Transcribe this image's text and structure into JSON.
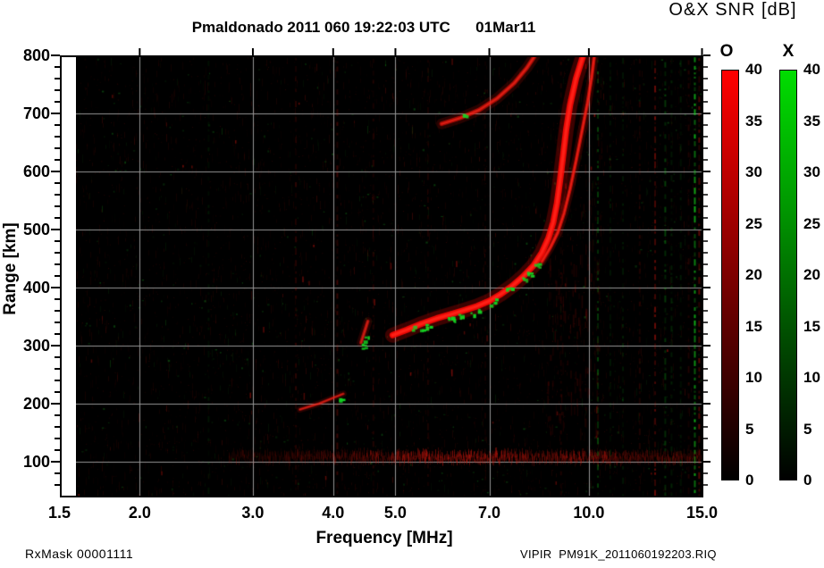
{
  "labels": {
    "title": "Pmaldonado 2011 060 19:22:03 UTC      01Mar11",
    "colorbar_title": "O&X SNR [dB]",
    "x_axis": "Frequency [MHz]",
    "y_axis": "Range [km]",
    "footer_left": "RxMask 00001111",
    "footer_right": "VIPIR  PM91K_2011060192203.RIQ"
  },
  "colorbar": {
    "o_label": "O",
    "x_label": "X",
    "ticks": [
      40,
      35,
      30,
      25,
      20,
      15,
      10,
      5,
      0
    ],
    "o_top_color": "#ff0000",
    "x_top_color": "#00dd00",
    "unit": "dB"
  },
  "chart_data": {
    "type": "heatmap",
    "description": "VIPIR ionogram: O-mode (red) and X-mode (green) SNR versus sounding frequency and virtual range",
    "title": "Pmaldonado 2011 060 19:22:03 UTC      01Mar11",
    "xlabel": "Frequency [MHz]",
    "ylabel": "Range [km]",
    "x_axis": {
      "scale": "log",
      "min": 1.5,
      "max": 15.0,
      "tick_values": [
        1.5,
        2.0,
        3.0,
        4.0,
        5.0,
        7.0,
        10.0,
        15.0
      ],
      "tick_labels": [
        "1.5",
        "2.0",
        "3.0",
        "4.0",
        "5.0",
        "7.0",
        "10.0",
        "15.0"
      ]
    },
    "y_axis": {
      "min": 40,
      "max": 800,
      "major_ticks": [
        100,
        200,
        300,
        400,
        500,
        600,
        700,
        800
      ],
      "minor_step": 20
    },
    "grid_x": [
      2.0,
      3.0,
      4.0,
      5.0,
      7.0,
      10.0,
      15.0
    ],
    "grid_y": [
      100,
      200,
      300,
      400,
      500,
      600,
      700
    ],
    "grid_color": "#969696",
    "background_color": "#000000",
    "o_mode_color": "#ff0a05",
    "x_mode_color": "#14d223",
    "traces": [
      {
        "name": "low virtual-height segment",
        "rgb": [
          235,
          20,
          12
        ],
        "width": 3,
        "alpha": 0.55,
        "points": [
          [
            3.55,
            190
          ],
          [
            3.8,
            200
          ],
          [
            4.15,
            217
          ]
        ]
      },
      {
        "name": "F1 cusp blob",
        "rgb": [
          225,
          18,
          12
        ],
        "width": 4,
        "alpha": 0.6,
        "points": [
          [
            4.42,
            305
          ],
          [
            4.47,
            322
          ],
          [
            4.53,
            342
          ]
        ]
      },
      {
        "name": "F-layer O-mode trace",
        "rgb": [
          255,
          10,
          5
        ],
        "width": 7,
        "alpha": 0.9,
        "points": [
          [
            4.95,
            318
          ],
          [
            5.2,
            327
          ],
          [
            5.5,
            338
          ],
          [
            5.8,
            347
          ],
          [
            6.1,
            354
          ],
          [
            6.4,
            361
          ],
          [
            6.7,
            368
          ],
          [
            7.0,
            377
          ],
          [
            7.3,
            389
          ],
          [
            7.6,
            403
          ],
          [
            7.9,
            419
          ],
          [
            8.2,
            438
          ],
          [
            8.45,
            460
          ],
          [
            8.65,
            485
          ],
          [
            8.8,
            512
          ],
          [
            8.92,
            545
          ],
          [
            9.02,
            585
          ],
          [
            9.12,
            628
          ],
          [
            9.22,
            672
          ],
          [
            9.35,
            715
          ],
          [
            9.55,
            760
          ],
          [
            9.8,
            800
          ]
        ]
      },
      {
        "name": "F-layer X-mode asymptote",
        "rgb": [
          235,
          15,
          8
        ],
        "width": 4,
        "alpha": 0.7,
        "points": [
          [
            8.45,
            445
          ],
          [
            8.7,
            468
          ],
          [
            8.95,
            495
          ],
          [
            9.15,
            528
          ],
          [
            9.35,
            570
          ],
          [
            9.55,
            618
          ],
          [
            9.75,
            668
          ],
          [
            9.95,
            718
          ],
          [
            10.1,
            762
          ],
          [
            10.2,
            800
          ]
        ]
      },
      {
        "name": "second-hop 2F trace",
        "rgb": [
          230,
          15,
          8
        ],
        "width": 5,
        "alpha": 0.65,
        "points": [
          [
            5.9,
            682
          ],
          [
            6.3,
            692
          ],
          [
            6.75,
            706
          ],
          [
            7.2,
            726
          ],
          [
            7.65,
            752
          ],
          [
            8.0,
            778
          ],
          [
            8.25,
            800
          ]
        ]
      }
    ],
    "green_specks": [
      [
        4.46,
        300
      ],
      [
        4.5,
        312
      ],
      [
        5.35,
        330
      ],
      [
        5.5,
        331
      ],
      [
        5.62,
        333
      ],
      [
        6.05,
        347
      ],
      [
        6.18,
        350
      ],
      [
        6.32,
        352
      ],
      [
        6.6,
        357
      ],
      [
        6.72,
        360
      ],
      [
        7.05,
        372
      ],
      [
        7.12,
        378
      ],
      [
        7.5,
        397
      ],
      [
        7.58,
        402
      ],
      [
        7.95,
        415
      ],
      [
        8.05,
        425
      ],
      [
        8.3,
        438
      ],
      [
        6.42,
        700
      ],
      [
        4.1,
        210
      ]
    ],
    "e_layer": {
      "range_km": 108,
      "f_start": 2.75,
      "f_end": 15.0,
      "base_alpha": 0.1,
      "humps": [
        [
          6.4,
          1.4,
          0.38
        ],
        [
          9.9,
          0.9,
          0.22
        ],
        [
          13.2,
          1.5,
          0.12
        ]
      ]
    },
    "rfi_lines": [
      {
        "f": 2.56,
        "mode": "x",
        "strength": 0.1
      },
      {
        "f": 3.5,
        "mode": "o",
        "strength": 0.2
      },
      {
        "f": 4.06,
        "mode": "o",
        "strength": 0.26
      },
      {
        "f": 4.62,
        "mode": "o",
        "strength": 0.15
      },
      {
        "f": 5.62,
        "mode": "o",
        "strength": 0.12
      },
      {
        "f": 6.9,
        "mode": "o",
        "strength": 0.1
      },
      {
        "f": 9.05,
        "mode": "o",
        "strength": 0.14
      },
      {
        "f": 10.33,
        "mode": "x",
        "strength": 0.3
      },
      {
        "f": 10.8,
        "mode": "x",
        "strength": 0.12
      },
      {
        "f": 11.3,
        "mode": "x",
        "strength": 0.14
      },
      {
        "f": 12.0,
        "mode": "o",
        "strength": 0.16
      },
      {
        "f": 12.68,
        "mode": "o",
        "strength": 0.45
      },
      {
        "f": 13.15,
        "mode": "x",
        "strength": 0.3
      },
      {
        "f": 13.45,
        "mode": "x",
        "strength": 0.15
      },
      {
        "f": 13.9,
        "mode": "x",
        "strength": 0.12
      },
      {
        "f": 14.3,
        "mode": "o",
        "strength": 0.14
      },
      {
        "f": 14.62,
        "mode": "x",
        "strength": 0.75
      },
      {
        "f": 14.85,
        "mode": "o",
        "strength": 0.4
      }
    ],
    "diffuse": [
      {
        "f1": 8.6,
        "f2": 10.4,
        "r1": 150,
        "r2": 460,
        "count": 130,
        "alpha": 0.16
      },
      {
        "f1": 9.8,
        "f2": 10.5,
        "r1": 450,
        "r2": 790,
        "count": 50,
        "alpha": 0.12
      }
    ],
    "noise": {
      "seed": 42,
      "column_dashes_min": 3,
      "column_dashes_rand": 4,
      "red_dots": 2600,
      "green_dots": 380,
      "bright_dashes": 40
    }
  }
}
